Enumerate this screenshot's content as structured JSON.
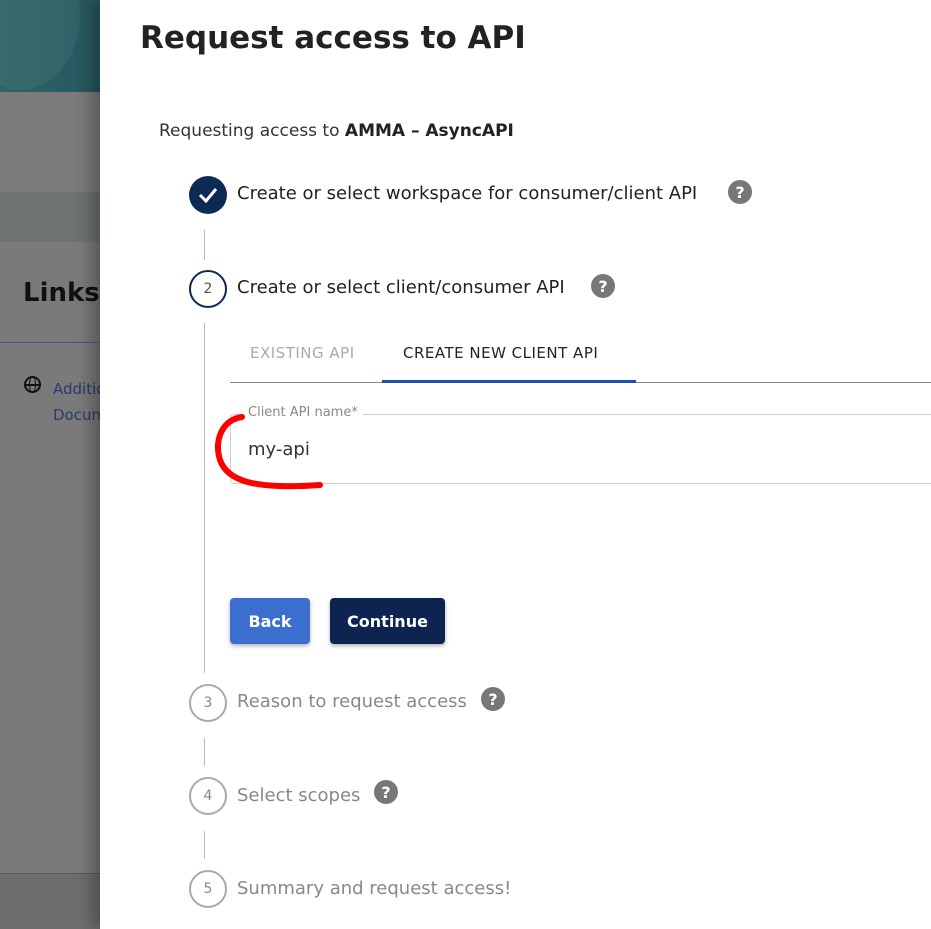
{
  "background": {
    "links_heading": "Links",
    "link_label": "Additional Documentation"
  },
  "dialog": {
    "title": "Request access to API",
    "requesting_prefix": "Requesting access to ",
    "api_name": "AMMA – AsyncAPI",
    "steps": [
      {
        "number": "1",
        "label": "Create or select workspace for consumer/client API",
        "status": "done"
      },
      {
        "number": "2",
        "label": "Create or select client/consumer API",
        "status": "active"
      },
      {
        "number": "3",
        "label": "Reason to request access",
        "status": "pending"
      },
      {
        "number": "4",
        "label": "Select scopes",
        "status": "pending"
      },
      {
        "number": "5",
        "label": "Summary and request access!",
        "status": "pending"
      }
    ],
    "tabs": [
      {
        "label": "EXISTING API",
        "selected": false
      },
      {
        "label": "CREATE NEW CLIENT API",
        "selected": true
      }
    ],
    "field": {
      "label": "Client API name",
      "required_mark": "*",
      "value": "my-api"
    },
    "back_label": "Back",
    "continue_label": "Continue",
    "help_glyph": "?"
  },
  "colors": {
    "navy": "#0d2a56",
    "blue": "#3a6fd0",
    "annotation": "#ff0000"
  }
}
